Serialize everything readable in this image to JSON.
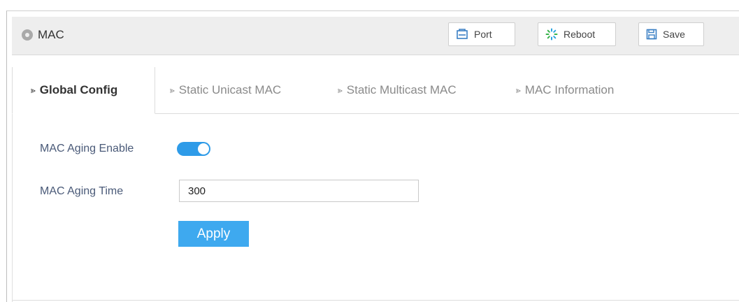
{
  "header": {
    "icon": "location-pin-icon",
    "title": "MAC",
    "buttons": {
      "port": {
        "label": "Port",
        "icon": "port-icon"
      },
      "reboot": {
        "label": "Reboot",
        "icon": "reboot-spinner-icon"
      },
      "save": {
        "label": "Save",
        "icon": "floppy-disk-icon"
      }
    }
  },
  "tabs": [
    {
      "label": "Global Config",
      "active": true
    },
    {
      "label": "Static Unicast MAC",
      "active": false
    },
    {
      "label": "Static Multicast MAC",
      "active": false
    },
    {
      "label": "MAC Information",
      "active": false
    }
  ],
  "form": {
    "aging_enable_label": "MAC Aging Enable",
    "aging_enable_value": true,
    "aging_time_label": "MAC Aging Time",
    "aging_time_value": "300",
    "apply_label": "Apply"
  },
  "colors": {
    "accent": "#3ea9ef",
    "toggle_on": "#2e9be8",
    "header_bg": "#eeeeee",
    "label_text": "#4a5a78"
  }
}
